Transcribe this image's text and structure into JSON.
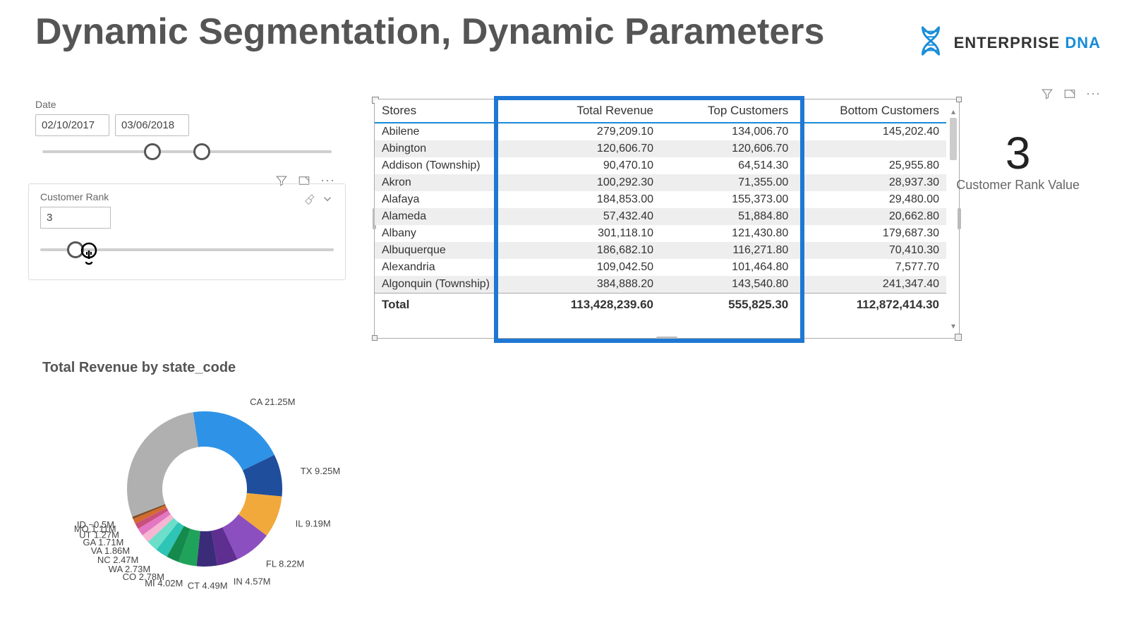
{
  "title": "Dynamic Segmentation, Dynamic Parameters",
  "brand": {
    "name": "ENTERPRISE",
    "accent": "DNA"
  },
  "date_slicer": {
    "label": "Date",
    "from": "02/10/2017",
    "to": "03/06/2018",
    "handle1_pct": 38,
    "handle2_pct": 55
  },
  "rank_slicer": {
    "label": "Customer Rank",
    "value": "3",
    "handle_pct": 12
  },
  "table": {
    "columns": [
      "Stores",
      "Total Revenue",
      "Top Customers",
      "Bottom Customers"
    ],
    "rows": [
      [
        "Abilene",
        "279,209.10",
        "134,006.70",
        "145,202.40"
      ],
      [
        "Abington",
        "120,606.70",
        "120,606.70",
        ""
      ],
      [
        "Addison (Township)",
        "90,470.10",
        "64,514.30",
        "25,955.80"
      ],
      [
        "Akron",
        "100,292.30",
        "71,355.00",
        "28,937.30"
      ],
      [
        "Alafaya",
        "184,853.00",
        "155,373.00",
        "29,480.00"
      ],
      [
        "Alameda",
        "57,432.40",
        "51,884.80",
        "20,662.80"
      ],
      [
        "Albany",
        "301,118.10",
        "121,430.80",
        "179,687.30"
      ],
      [
        "Albuquerque",
        "186,682.10",
        "116,271.80",
        "70,410.30"
      ],
      [
        "Alexandria",
        "109,042.50",
        "101,464.80",
        "7,577.70"
      ],
      [
        "Algonquin (Township)",
        "384,888.20",
        "143,540.80",
        "241,347.40"
      ]
    ],
    "totals": [
      "Total",
      "113,428,239.60",
      "555,825.30",
      "112,872,414.30"
    ]
  },
  "card": {
    "value": "3",
    "label": "Customer Rank Value"
  },
  "chart_data": {
    "type": "pie",
    "title": "Total Revenue by state_code",
    "unit": "M",
    "series": [
      {
        "name": "CA",
        "label": "CA 21.25M",
        "value": 21.25,
        "color": "#2E93E6"
      },
      {
        "name": "TX",
        "label": "TX 9.25M",
        "value": 9.25,
        "color": "#1F4E9C"
      },
      {
        "name": "IL",
        "label": "IL 9.19M",
        "value": 9.19,
        "color": "#F2A93B"
      },
      {
        "name": "FL",
        "label": "FL 8.22M",
        "value": 8.22,
        "color": "#8B4FBF"
      },
      {
        "name": "IN",
        "label": "IN 4.57M",
        "value": 4.57,
        "color": "#5E2E91"
      },
      {
        "name": "CT",
        "label": "CT 4.49M",
        "value": 4.49,
        "color": "#3B2C7A"
      },
      {
        "name": "MI",
        "label": "MI 4.02M",
        "value": 4.02,
        "color": "#1FA35A"
      },
      {
        "name": "CO",
        "label": "CO 2.78M",
        "value": 2.78,
        "color": "#148A4C"
      },
      {
        "name": "WA",
        "label": "WA 2.73M",
        "value": 2.73,
        "color": "#2EC4B6"
      },
      {
        "name": "NC",
        "label": "NC 2.47M",
        "value": 2.47,
        "color": "#6BDFC9"
      },
      {
        "name": "VA",
        "label": "VA 1.86M",
        "value": 1.86,
        "color": "#F7B6D2"
      },
      {
        "name": "GA",
        "label": "GA 1.71M",
        "value": 1.71,
        "color": "#E377C2"
      },
      {
        "name": "UT",
        "label": "UT 1.27M",
        "value": 1.27,
        "color": "#C94F7C"
      },
      {
        "name": "MO",
        "label": "MO 1.11M",
        "value": 1.11,
        "color": "#D46A2E"
      },
      {
        "name": "ID",
        "label": "ID ~0.5M",
        "value": 0.5,
        "color": "#7F4F24"
      },
      {
        "name": "other",
        "label": "",
        "value": 30.0,
        "color": "#b0b0b0",
        "remainder": true
      }
    ]
  }
}
